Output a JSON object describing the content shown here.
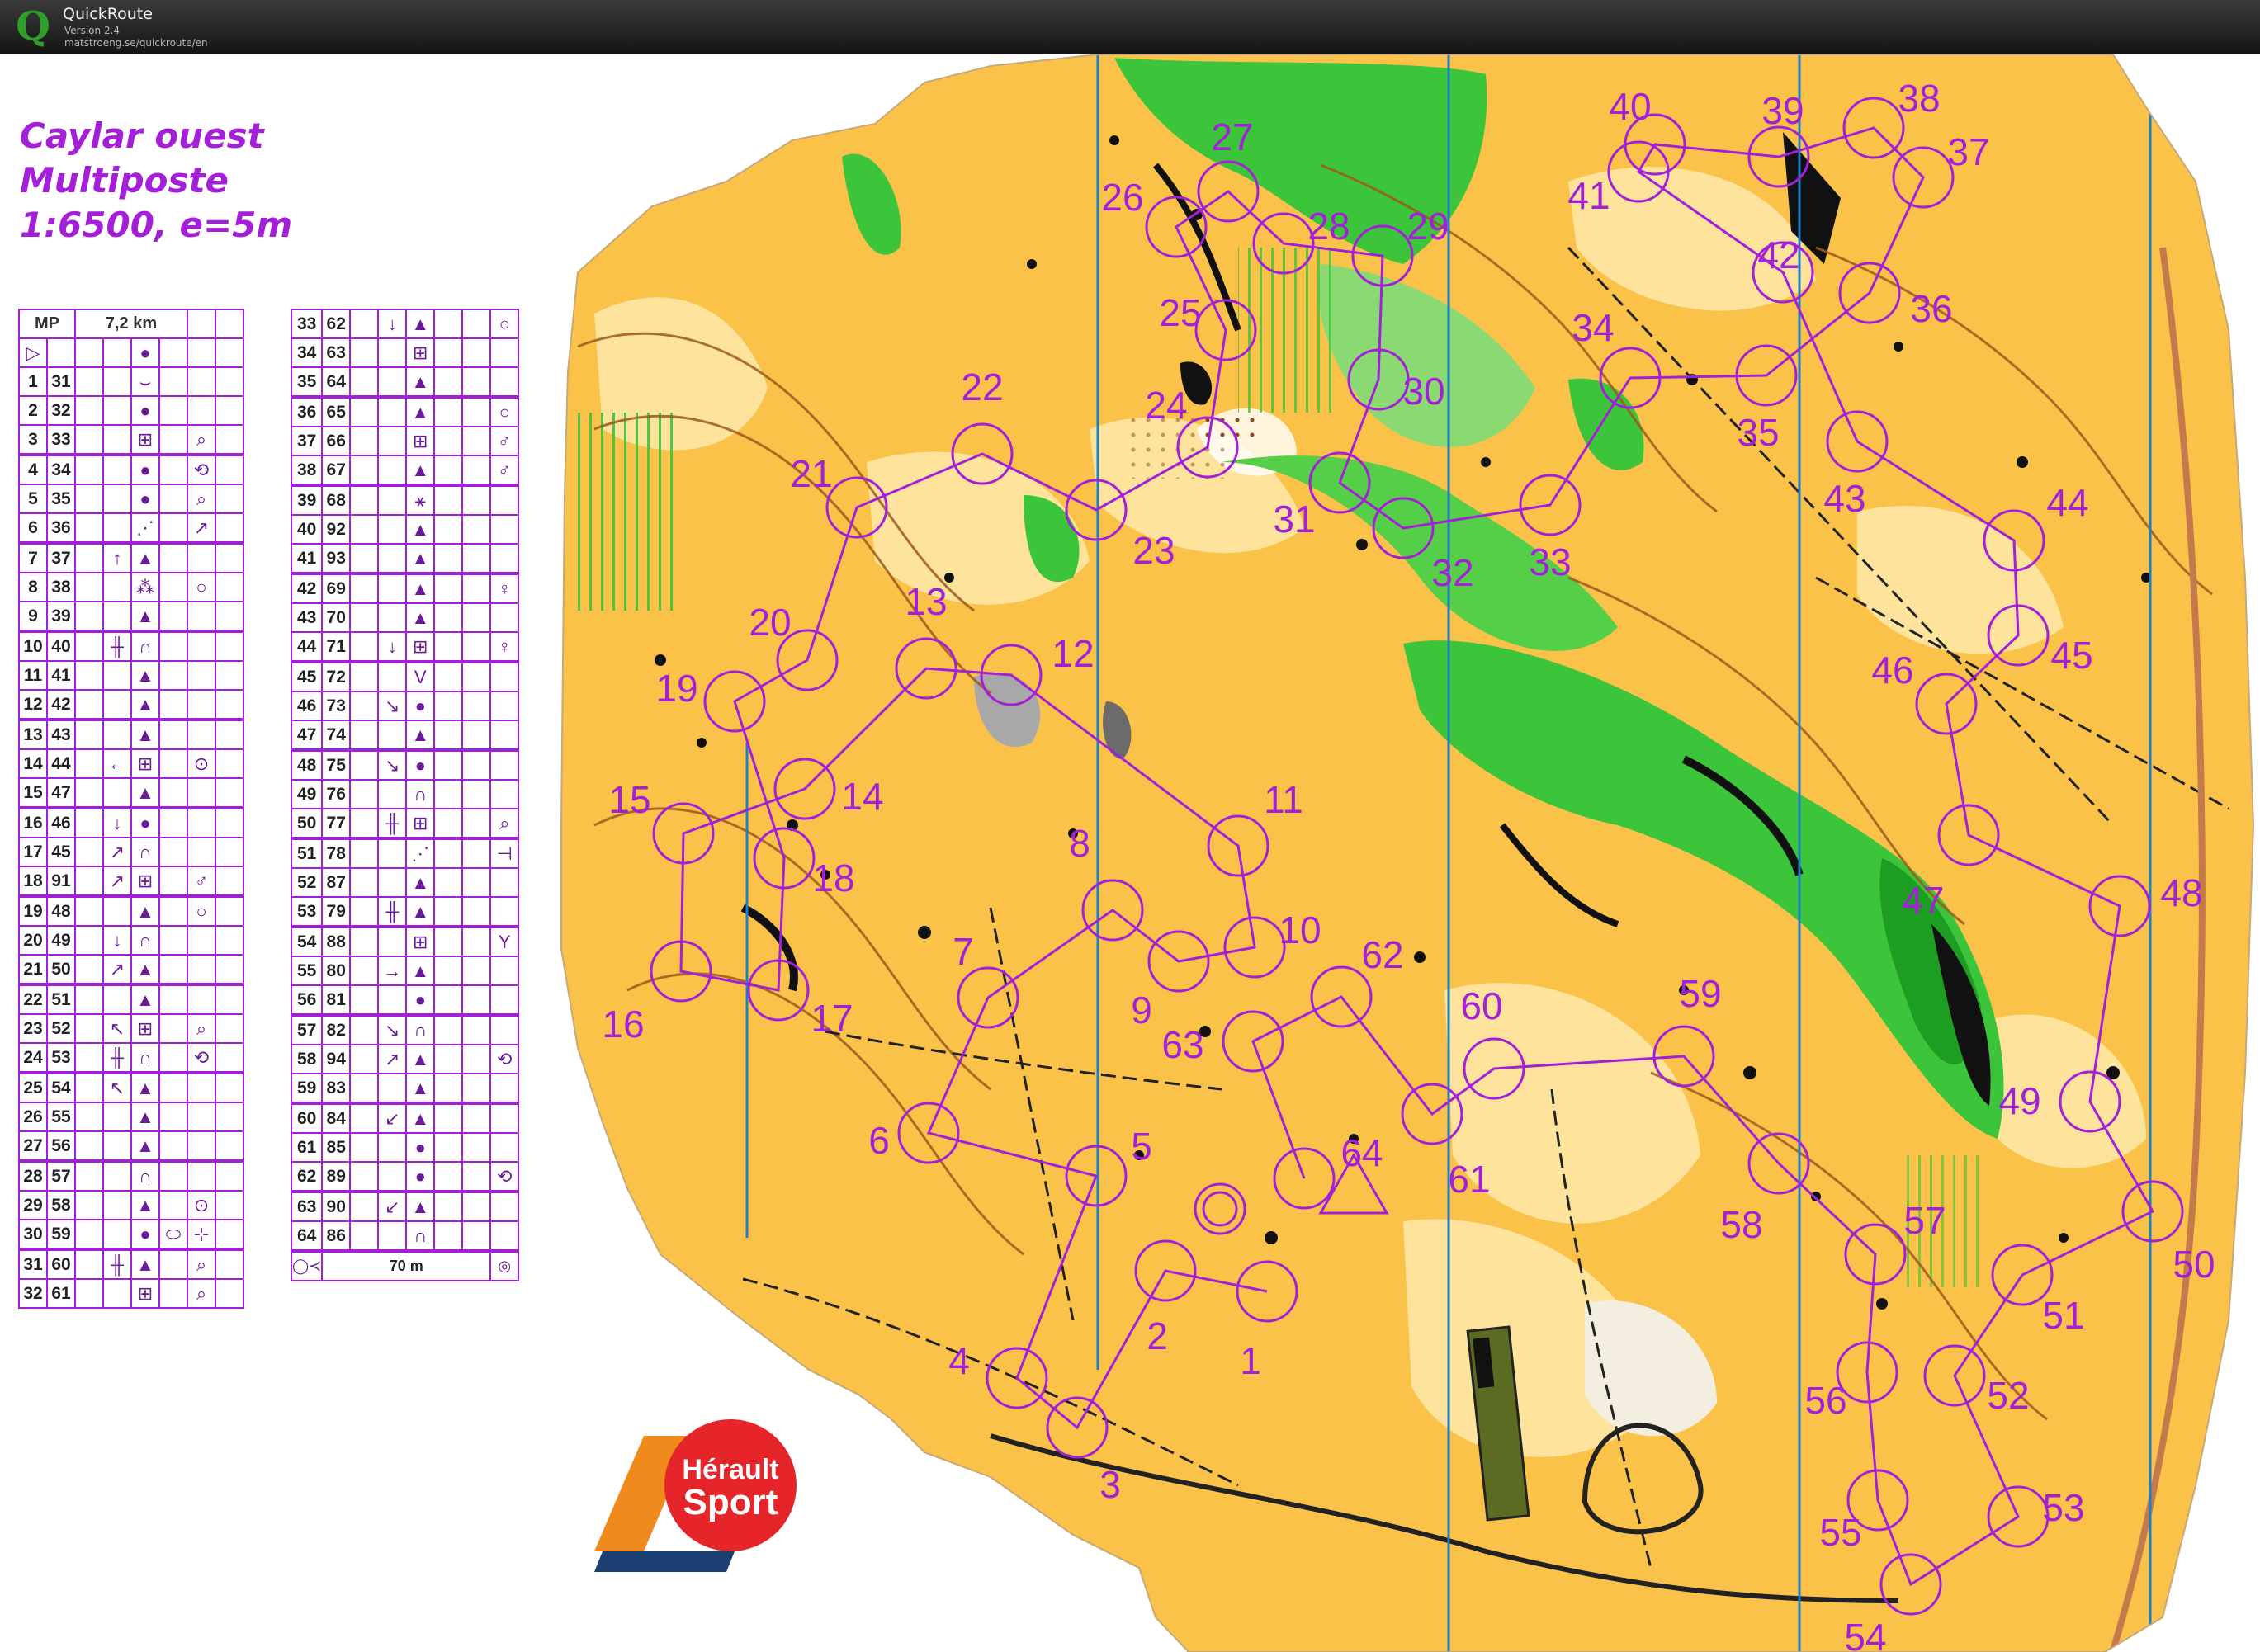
{
  "app": {
    "name": "QuickRoute",
    "version": "Version 2.4",
    "url": "matstroeng.se/quickroute/en",
    "logo_letter": "Q"
  },
  "map_title": {
    "line1": "Caylar ouest",
    "line2": "Multiposte",
    "line3": "1:6500, e=5m"
  },
  "control_description": {
    "event_code": "MP",
    "course_length": "7,2 km",
    "finish_distance": "70 m",
    "left_rows": [
      {
        "n": "1",
        "code": "31",
        "c": "",
        "d": "",
        "e": "⌣",
        "f": "",
        "g": "",
        "h": ""
      },
      {
        "n": "2",
        "code": "32",
        "c": "",
        "d": "",
        "e": "●",
        "f": "",
        "g": "",
        "h": ""
      },
      {
        "n": "3",
        "code": "33",
        "c": "",
        "d": "",
        "e": "⊞",
        "f": "",
        "g": "⌕",
        "h": ""
      },
      {
        "n": "4",
        "code": "34",
        "c": "",
        "d": "",
        "e": "●",
        "f": "",
        "g": "⟲",
        "h": ""
      },
      {
        "n": "5",
        "code": "35",
        "c": "",
        "d": "",
        "e": "●",
        "f": "",
        "g": "⌕",
        "h": ""
      },
      {
        "n": "6",
        "code": "36",
        "c": "",
        "d": "",
        "e": "⋰",
        "f": "",
        "g": "↗",
        "h": ""
      },
      {
        "n": "7",
        "code": "37",
        "c": "",
        "d": "↑",
        "e": "▲",
        "f": "",
        "g": "",
        "h": ""
      },
      {
        "n": "8",
        "code": "38",
        "c": "",
        "d": "",
        "e": "⁂",
        "f": "",
        "g": "○",
        "h": ""
      },
      {
        "n": "9",
        "code": "39",
        "c": "",
        "d": "",
        "e": "▲",
        "f": "",
        "g": "",
        "h": ""
      },
      {
        "n": "10",
        "code": "40",
        "c": "",
        "d": "╫",
        "e": "∩",
        "f": "",
        "g": "",
        "h": ""
      },
      {
        "n": "11",
        "code": "41",
        "c": "",
        "d": "",
        "e": "▲",
        "f": "",
        "g": "",
        "h": ""
      },
      {
        "n": "12",
        "code": "42",
        "c": "",
        "d": "",
        "e": "▲",
        "f": "",
        "g": "",
        "h": ""
      },
      {
        "n": "13",
        "code": "43",
        "c": "",
        "d": "",
        "e": "▲",
        "f": "",
        "g": "",
        "h": ""
      },
      {
        "n": "14",
        "code": "44",
        "c": "",
        "d": "←",
        "e": "⊞",
        "f": "",
        "g": "⊙",
        "h": ""
      },
      {
        "n": "15",
        "code": "47",
        "c": "",
        "d": "",
        "e": "▲",
        "f": "",
        "g": "",
        "h": ""
      },
      {
        "n": "16",
        "code": "46",
        "c": "",
        "d": "↓",
        "e": "●",
        "f": "",
        "g": "",
        "h": ""
      },
      {
        "n": "17",
        "code": "45",
        "c": "",
        "d": "↗",
        "e": "∩",
        "f": "",
        "g": "",
        "h": ""
      },
      {
        "n": "18",
        "code": "91",
        "c": "",
        "d": "↗",
        "e": "⊞",
        "f": "",
        "g": "♂",
        "h": ""
      },
      {
        "n": "19",
        "code": "48",
        "c": "",
        "d": "",
        "e": "▲",
        "f": "",
        "g": "○",
        "h": ""
      },
      {
        "n": "20",
        "code": "49",
        "c": "",
        "d": "↓",
        "e": "∩",
        "f": "",
        "g": "",
        "h": ""
      },
      {
        "n": "21",
        "code": "50",
        "c": "",
        "d": "↗",
        "e": "▲",
        "f": "",
        "g": "",
        "h": ""
      },
      {
        "n": "22",
        "code": "51",
        "c": "",
        "d": "",
        "e": "▲",
        "f": "",
        "g": "",
        "h": ""
      },
      {
        "n": "23",
        "code": "52",
        "c": "",
        "d": "↖",
        "e": "⊞",
        "f": "",
        "g": "⌕",
        "h": ""
      },
      {
        "n": "24",
        "code": "53",
        "c": "",
        "d": "╫",
        "e": "∩",
        "f": "",
        "g": "⟲",
        "h": ""
      },
      {
        "n": "25",
        "code": "54",
        "c": "",
        "d": "↖",
        "e": "▲",
        "f": "",
        "g": "",
        "h": ""
      },
      {
        "n": "26",
        "code": "55",
        "c": "",
        "d": "",
        "e": "▲",
        "f": "",
        "g": "",
        "h": ""
      },
      {
        "n": "27",
        "code": "56",
        "c": "",
        "d": "",
        "e": "▲",
        "f": "",
        "g": "",
        "h": ""
      },
      {
        "n": "28",
        "code": "57",
        "c": "",
        "d": "",
        "e": "∩",
        "f": "",
        "g": "",
        "h": ""
      },
      {
        "n": "29",
        "code": "58",
        "c": "",
        "d": "",
        "e": "▲",
        "f": "",
        "g": "⊙",
        "h": ""
      },
      {
        "n": "30",
        "code": "59",
        "c": "",
        "d": "",
        "e": "●",
        "f": "⬭",
        "g": "⊹",
        "h": ""
      },
      {
        "n": "31",
        "code": "60",
        "c": "",
        "d": "╫",
        "e": "▲",
        "f": "",
        "g": "⌕",
        "h": ""
      },
      {
        "n": "32",
        "code": "61",
        "c": "",
        "d": "",
        "e": "⊞",
        "f": "",
        "g": "⌕",
        "h": ""
      }
    ],
    "right_rows": [
      {
        "n": "33",
        "code": "62",
        "c": "",
        "d": "↓",
        "e": "▲",
        "f": "",
        "g": "",
        "h": "○"
      },
      {
        "n": "34",
        "code": "63",
        "c": "",
        "d": "",
        "e": "⊞",
        "f": "",
        "g": "",
        "h": ""
      },
      {
        "n": "35",
        "code": "64",
        "c": "",
        "d": "",
        "e": "▲",
        "f": "",
        "g": "",
        "h": ""
      },
      {
        "n": "36",
        "code": "65",
        "c": "",
        "d": "",
        "e": "▲",
        "f": "",
        "g": "",
        "h": "○"
      },
      {
        "n": "37",
        "code": "66",
        "c": "",
        "d": "",
        "e": "⊞",
        "f": "",
        "g": "",
        "h": "♂"
      },
      {
        "n": "38",
        "code": "67",
        "c": "",
        "d": "",
        "e": "▲",
        "f": "",
        "g": "",
        "h": "♂"
      },
      {
        "n": "39",
        "code": "68",
        "c": "",
        "d": "",
        "e": "⚹",
        "f": "",
        "g": "",
        "h": ""
      },
      {
        "n": "40",
        "code": "92",
        "c": "",
        "d": "",
        "e": "▲",
        "f": "",
        "g": "",
        "h": ""
      },
      {
        "n": "41",
        "code": "93",
        "c": "",
        "d": "",
        "e": "▲",
        "f": "",
        "g": "",
        "h": ""
      },
      {
        "n": "42",
        "code": "69",
        "c": "",
        "d": "",
        "e": "▲",
        "f": "",
        "g": "",
        "h": "♀"
      },
      {
        "n": "43",
        "code": "70",
        "c": "",
        "d": "",
        "e": "▲",
        "f": "",
        "g": "",
        "h": ""
      },
      {
        "n": "44",
        "code": "71",
        "c": "",
        "d": "↓",
        "e": "⊞",
        "f": "",
        "g": "",
        "h": "♀"
      },
      {
        "n": "45",
        "code": "72",
        "c": "",
        "d": "",
        "e": "V",
        "f": "",
        "g": "",
        "h": ""
      },
      {
        "n": "46",
        "code": "73",
        "c": "",
        "d": "↘",
        "e": "●",
        "f": "",
        "g": "",
        "h": ""
      },
      {
        "n": "47",
        "code": "74",
        "c": "",
        "d": "",
        "e": "▲",
        "f": "",
        "g": "",
        "h": ""
      },
      {
        "n": "48",
        "code": "75",
        "c": "",
        "d": "↘",
        "e": "●",
        "f": "",
        "g": "",
        "h": ""
      },
      {
        "n": "49",
        "code": "76",
        "c": "",
        "d": "",
        "e": "∩",
        "f": "",
        "g": "",
        "h": ""
      },
      {
        "n": "50",
        "code": "77",
        "c": "",
        "d": "╫",
        "e": "⊞",
        "f": "",
        "g": "",
        "h": "⌕"
      },
      {
        "n": "51",
        "code": "78",
        "c": "",
        "d": "",
        "e": "⋰",
        "f": "",
        "g": "",
        "h": "⊣"
      },
      {
        "n": "52",
        "code": "87",
        "c": "",
        "d": "",
        "e": "▲",
        "f": "",
        "g": "",
        "h": ""
      },
      {
        "n": "53",
        "code": "79",
        "c": "",
        "d": "╫",
        "e": "▲",
        "f": "",
        "g": "",
        "h": ""
      },
      {
        "n": "54",
        "code": "88",
        "c": "",
        "d": "",
        "e": "⊞",
        "f": "",
        "g": "",
        "h": "Y"
      },
      {
        "n": "55",
        "code": "80",
        "c": "",
        "d": "→",
        "e": "▲",
        "f": "",
        "g": "",
        "h": ""
      },
      {
        "n": "56",
        "code": "81",
        "c": "",
        "d": "",
        "e": "●",
        "f": "",
        "g": "",
        "h": ""
      },
      {
        "n": "57",
        "code": "82",
        "c": "",
        "d": "↘",
        "e": "∩",
        "f": "",
        "g": "",
        "h": ""
      },
      {
        "n": "58",
        "code": "94",
        "c": "",
        "d": "↗",
        "e": "▲",
        "f": "",
        "g": "",
        "h": "⟲"
      },
      {
        "n": "59",
        "code": "83",
        "c": "",
        "d": "",
        "e": "▲",
        "f": "",
        "g": "",
        "h": ""
      },
      {
        "n": "60",
        "code": "84",
        "c": "",
        "d": "↙",
        "e": "▲",
        "f": "",
        "g": "",
        "h": ""
      },
      {
        "n": "61",
        "code": "85",
        "c": "",
        "d": "",
        "e": "●",
        "f": "",
        "g": "",
        "h": ""
      },
      {
        "n": "62",
        "code": "89",
        "c": "",
        "d": "",
        "e": "●",
        "f": "",
        "g": "",
        "h": "⟲"
      },
      {
        "n": "63",
        "code": "90",
        "c": "",
        "d": "↙",
        "e": "▲",
        "f": "",
        "g": "",
        "h": ""
      },
      {
        "n": "64",
        "code": "86",
        "c": "",
        "d": "",
        "e": "∩",
        "f": "",
        "g": "",
        "h": ""
      }
    ]
  },
  "controls": [
    "1",
    "2",
    "3",
    "4",
    "5",
    "6",
    "7",
    "8",
    "9",
    "10",
    "11",
    "12",
    "13",
    "14",
    "15",
    "16",
    "17",
    "18",
    "19",
    "20",
    "21",
    "22",
    "23",
    "24",
    "25",
    "26",
    "27",
    "28",
    "29",
    "30",
    "31",
    "32",
    "33",
    "34",
    "35",
    "36",
    "37",
    "38",
    "39",
    "40",
    "41",
    "42",
    "43",
    "44",
    "45",
    "46",
    "47",
    "48",
    "49",
    "50",
    "51",
    "52",
    "53",
    "54",
    "55",
    "56",
    "57",
    "58",
    "59",
    "60",
    "61",
    "62",
    "63",
    "64"
  ],
  "sponsor": {
    "line1": "Hérault",
    "line2": "Sport"
  },
  "colors": {
    "course": "#a31fd8",
    "open_land": "#fbc24a",
    "rough_open": "#fde39b",
    "forest_green": "#3cc43a",
    "contour": "#9c5a1b",
    "magnetic_north": "#1f7fc4",
    "logo_red": "#e52529",
    "logo_blue": "#1b3e73",
    "logo_orange": "#f08a1c"
  }
}
